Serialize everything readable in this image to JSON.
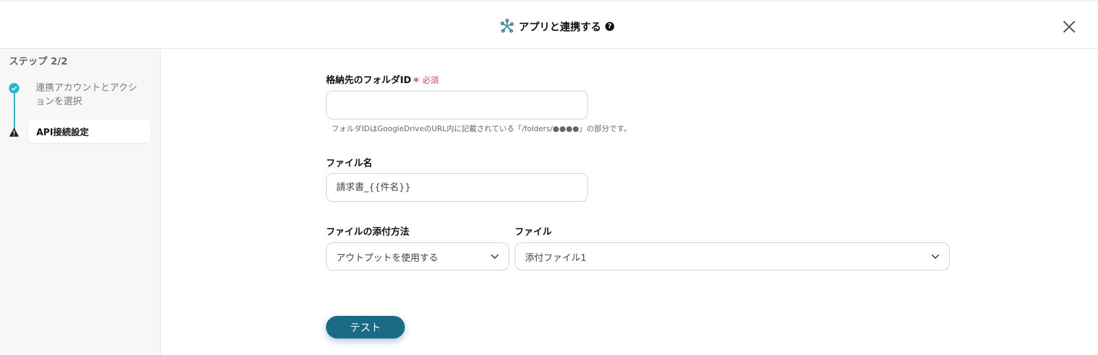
{
  "header": {
    "title": "アプリと連携する",
    "help": "?"
  },
  "sidebar": {
    "step_label": "ステップ 2/2",
    "steps": [
      {
        "label": "連携アカウントとアクションを選択",
        "status": "done"
      },
      {
        "label": "API接続設定",
        "status": "warning"
      }
    ]
  },
  "form": {
    "folder_id": {
      "label": "格納先のフォルダID",
      "required": "必須",
      "value": "",
      "placeholder": "",
      "help": "フォルダIDはGoogleDriveのURL内に記載されている「/folders/●●●●」の部分です。"
    },
    "file_name": {
      "label": "ファイル名",
      "value": "請求書_{{件名}}"
    },
    "attach_method": {
      "label": "ファイルの添付方法",
      "selected": "アウトプットを使用する"
    },
    "file": {
      "label": "ファイル",
      "selected": "添付ファイル1"
    },
    "test_button": "テスト"
  },
  "colors": {
    "accent": "#1fb8cf",
    "primary_button": "#1a6b85",
    "required": "#e04a5a"
  }
}
